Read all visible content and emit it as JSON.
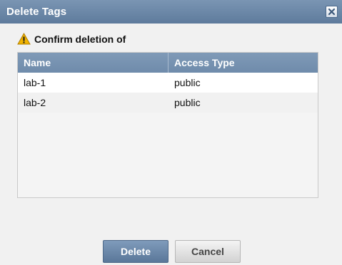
{
  "dialog": {
    "title": "Delete Tags",
    "close_icon": "close-x-icon",
    "warning_icon": "warning-triangle-icon",
    "confirm_text": "Confirm deletion of"
  },
  "table": {
    "columns": [
      "Name",
      "Access Type"
    ],
    "rows": [
      {
        "name": "lab-1",
        "access_type": "public"
      },
      {
        "name": "lab-2",
        "access_type": "public"
      }
    ]
  },
  "buttons": {
    "delete": "Delete",
    "cancel": "Cancel"
  },
  "colors": {
    "titlebar": "#6b87a8",
    "header": "#7892b0",
    "primary_button": "#6d89aa",
    "warning": "#f0b400"
  }
}
